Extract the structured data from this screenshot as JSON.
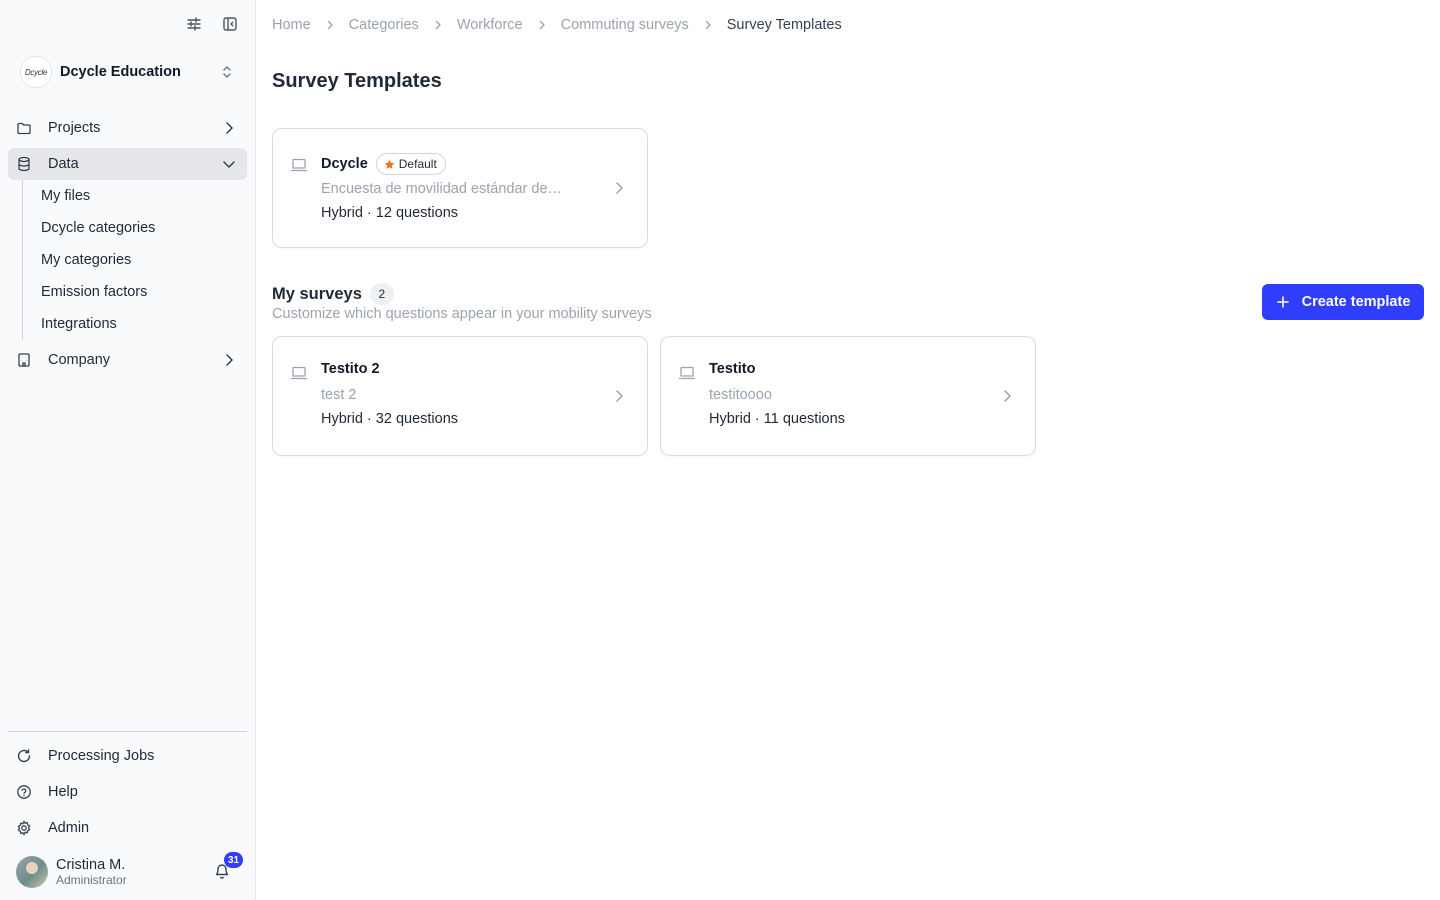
{
  "org": {
    "logo_text": "Dcycle",
    "name": "Dcycle Education"
  },
  "nav": {
    "items": [
      {
        "label": "Projects"
      },
      {
        "label": "Data"
      },
      {
        "label": "Company"
      }
    ],
    "data_sub": [
      "My files",
      "Dcycle categories",
      "My categories",
      "Emission factors",
      "Integrations"
    ],
    "bottom": [
      {
        "label": "Processing Jobs"
      },
      {
        "label": "Help"
      },
      {
        "label": "Admin"
      }
    ]
  },
  "user": {
    "name": "Cristina M.",
    "role": "Administrator",
    "notifications": "31"
  },
  "breadcrumb": [
    "Home",
    "Categories",
    "Workforce",
    "Commuting surveys",
    "Survey Templates"
  ],
  "page": {
    "title": "Survey Templates"
  },
  "default_card": {
    "title": "Dcycle",
    "badge": "Default",
    "description": "Encuesta de movilidad estándar de…",
    "meta": "Hybrid · 12 questions"
  },
  "my_surveys": {
    "title": "My surveys",
    "count": "2",
    "subtitle": "Customize which questions appear in your mobility surveys",
    "create_label": "Create template",
    "cards": [
      {
        "title": "Testito 2",
        "description": "test 2",
        "meta": "Hybrid · 32 questions"
      },
      {
        "title": "Testito",
        "description": "testitoooo",
        "meta": "Hybrid · 11 questions"
      }
    ]
  },
  "colors": {
    "primary": "#2f3dfc",
    "star": "#f97316",
    "sidebar_bg": "#f8fafc"
  }
}
